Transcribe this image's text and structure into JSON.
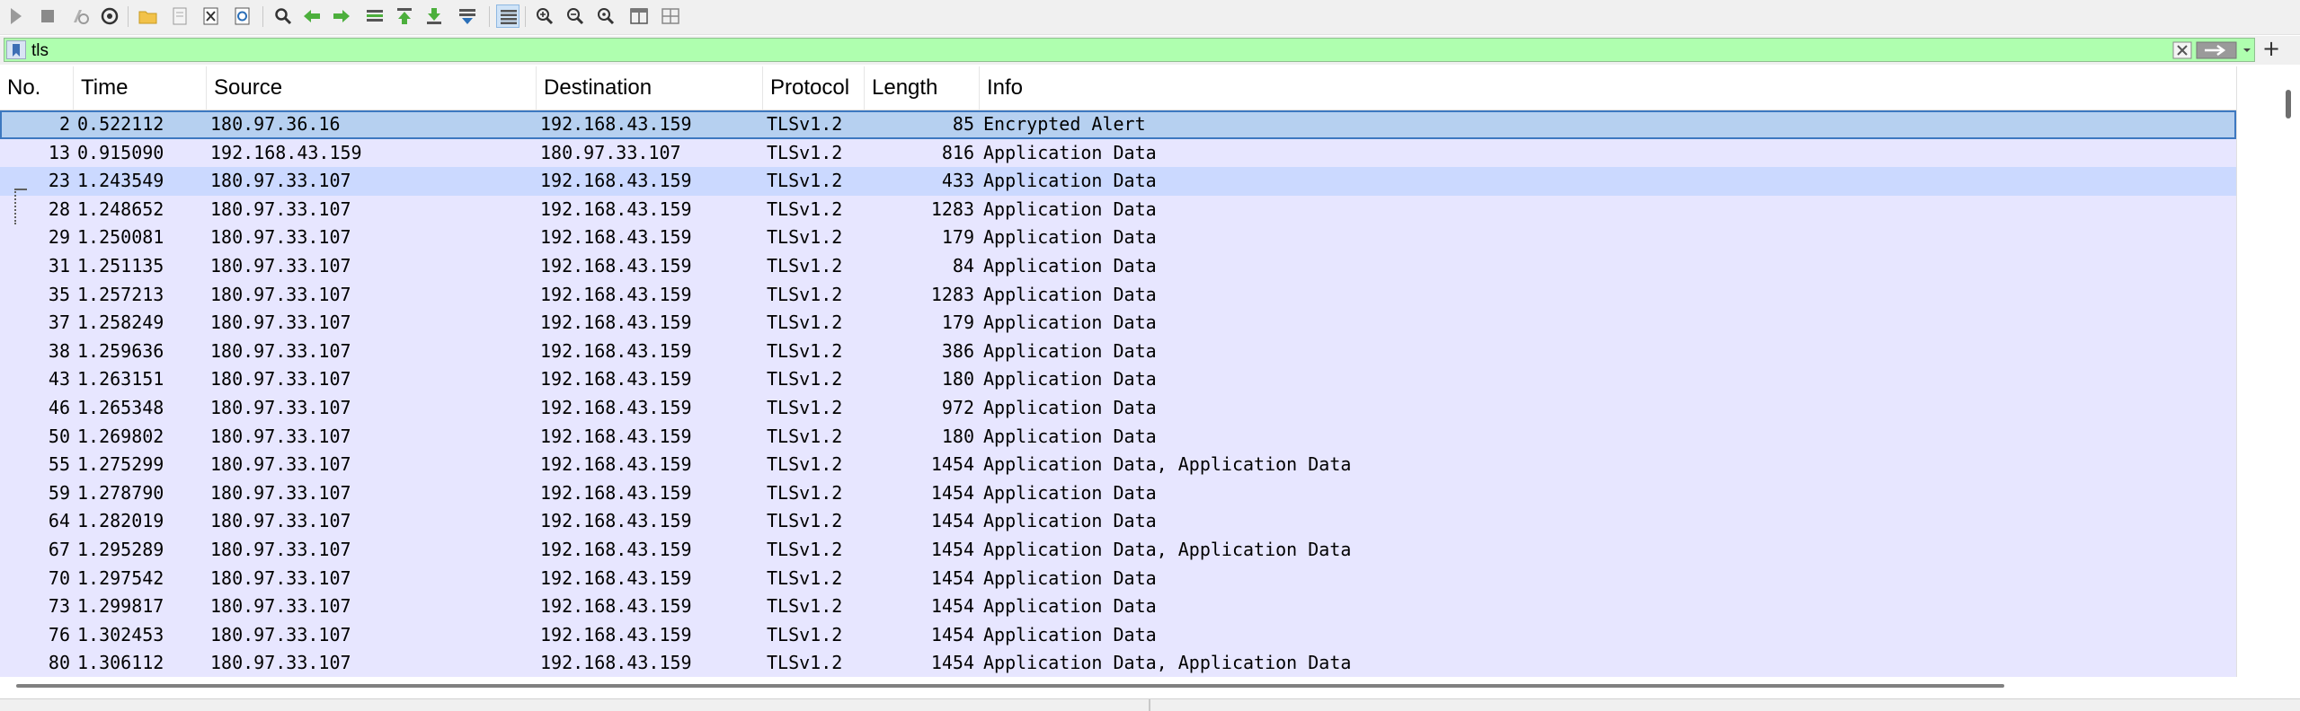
{
  "toolbar": {
    "icons": [
      "start-capture-icon",
      "stop-capture-icon",
      "restart-capture-icon",
      "capture-options-icon",
      "open-file-icon",
      "save-file-icon",
      "close-file-icon",
      "reload-file-icon",
      "find-packet-icon",
      "go-back-icon",
      "go-forward-icon",
      "go-to-packet-icon",
      "go-first-packet-icon",
      "go-last-packet-icon",
      "autoscroll-icon",
      "colorize-icon",
      "zoom-in-icon",
      "zoom-out-icon",
      "zoom-normal-icon",
      "resize-columns-icon",
      "layout-icon"
    ]
  },
  "filter": {
    "value": "tls",
    "background": "#afffaf",
    "clear_icon": "clear-filter-icon",
    "apply_icon": "apply-filter-arrow-icon",
    "add_label": "+"
  },
  "columns": {
    "no": "No.",
    "time": "Time",
    "source": "Source",
    "destination": "Destination",
    "protocol": "Protocol",
    "length": "Length",
    "info": "Info"
  },
  "colors": {
    "row_bg": "#e7e6ff",
    "selected_bg": "#b6d0f0",
    "selected_border": "#3d78c0"
  },
  "packets": [
    {
      "no": "2",
      "time": "0.522112",
      "source": "180.97.36.16",
      "destination": "192.168.43.159",
      "protocol": "TLSv1.2",
      "length": "85",
      "info": "Encrypted Alert"
    },
    {
      "no": "13",
      "time": "0.915090",
      "source": "192.168.43.159",
      "destination": "180.97.33.107",
      "protocol": "TLSv1.2",
      "length": "816",
      "info": "Application Data"
    },
    {
      "no": "23",
      "time": "1.243549",
      "source": "180.97.33.107",
      "destination": "192.168.43.159",
      "protocol": "TLSv1.2",
      "length": "433",
      "info": "Application Data"
    },
    {
      "no": "28",
      "time": "1.248652",
      "source": "180.97.33.107",
      "destination": "192.168.43.159",
      "protocol": "TLSv1.2",
      "length": "1283",
      "info": "Application Data"
    },
    {
      "no": "29",
      "time": "1.250081",
      "source": "180.97.33.107",
      "destination": "192.168.43.159",
      "protocol": "TLSv1.2",
      "length": "179",
      "info": "Application Data"
    },
    {
      "no": "31",
      "time": "1.251135",
      "source": "180.97.33.107",
      "destination": "192.168.43.159",
      "protocol": "TLSv1.2",
      "length": "84",
      "info": "Application Data"
    },
    {
      "no": "35",
      "time": "1.257213",
      "source": "180.97.33.107",
      "destination": "192.168.43.159",
      "protocol": "TLSv1.2",
      "length": "1283",
      "info": "Application Data"
    },
    {
      "no": "37",
      "time": "1.258249",
      "source": "180.97.33.107",
      "destination": "192.168.43.159",
      "protocol": "TLSv1.2",
      "length": "179",
      "info": "Application Data"
    },
    {
      "no": "38",
      "time": "1.259636",
      "source": "180.97.33.107",
      "destination": "192.168.43.159",
      "protocol": "TLSv1.2",
      "length": "386",
      "info": "Application Data"
    },
    {
      "no": "43",
      "time": "1.263151",
      "source": "180.97.33.107",
      "destination": "192.168.43.159",
      "protocol": "TLSv1.2",
      "length": "180",
      "info": "Application Data"
    },
    {
      "no": "46",
      "time": "1.265348",
      "source": "180.97.33.107",
      "destination": "192.168.43.159",
      "protocol": "TLSv1.2",
      "length": "972",
      "info": "Application Data"
    },
    {
      "no": "50",
      "time": "1.269802",
      "source": "180.97.33.107",
      "destination": "192.168.43.159",
      "protocol": "TLSv1.2",
      "length": "180",
      "info": "Application Data"
    },
    {
      "no": "55",
      "time": "1.275299",
      "source": "180.97.33.107",
      "destination": "192.168.43.159",
      "protocol": "TLSv1.2",
      "length": "1454",
      "info": "Application Data, Application Data"
    },
    {
      "no": "59",
      "time": "1.278790",
      "source": "180.97.33.107",
      "destination": "192.168.43.159",
      "protocol": "TLSv1.2",
      "length": "1454",
      "info": "Application Data"
    },
    {
      "no": "64",
      "time": "1.282019",
      "source": "180.97.33.107",
      "destination": "192.168.43.159",
      "protocol": "TLSv1.2",
      "length": "1454",
      "info": "Application Data"
    },
    {
      "no": "67",
      "time": "1.295289",
      "source": "180.97.33.107",
      "destination": "192.168.43.159",
      "protocol": "TLSv1.2",
      "length": "1454",
      "info": "Application Data, Application Data"
    },
    {
      "no": "70",
      "time": "1.297542",
      "source": "180.97.33.107",
      "destination": "192.168.43.159",
      "protocol": "TLSv1.2",
      "length": "1454",
      "info": "Application Data"
    },
    {
      "no": "73",
      "time": "1.299817",
      "source": "180.97.33.107",
      "destination": "192.168.43.159",
      "protocol": "TLSv1.2",
      "length": "1454",
      "info": "Application Data"
    },
    {
      "no": "76",
      "time": "1.302453",
      "source": "180.97.33.107",
      "destination": "192.168.43.159",
      "protocol": "TLSv1.2",
      "length": "1454",
      "info": "Application Data"
    },
    {
      "no": "80",
      "time": "1.306112",
      "source": "180.97.33.107",
      "destination": "192.168.43.159",
      "protocol": "TLSv1.2",
      "length": "1454",
      "info": "Application Data, Application Data"
    }
  ],
  "selected_row_index": 0,
  "hover_row_index": 2
}
